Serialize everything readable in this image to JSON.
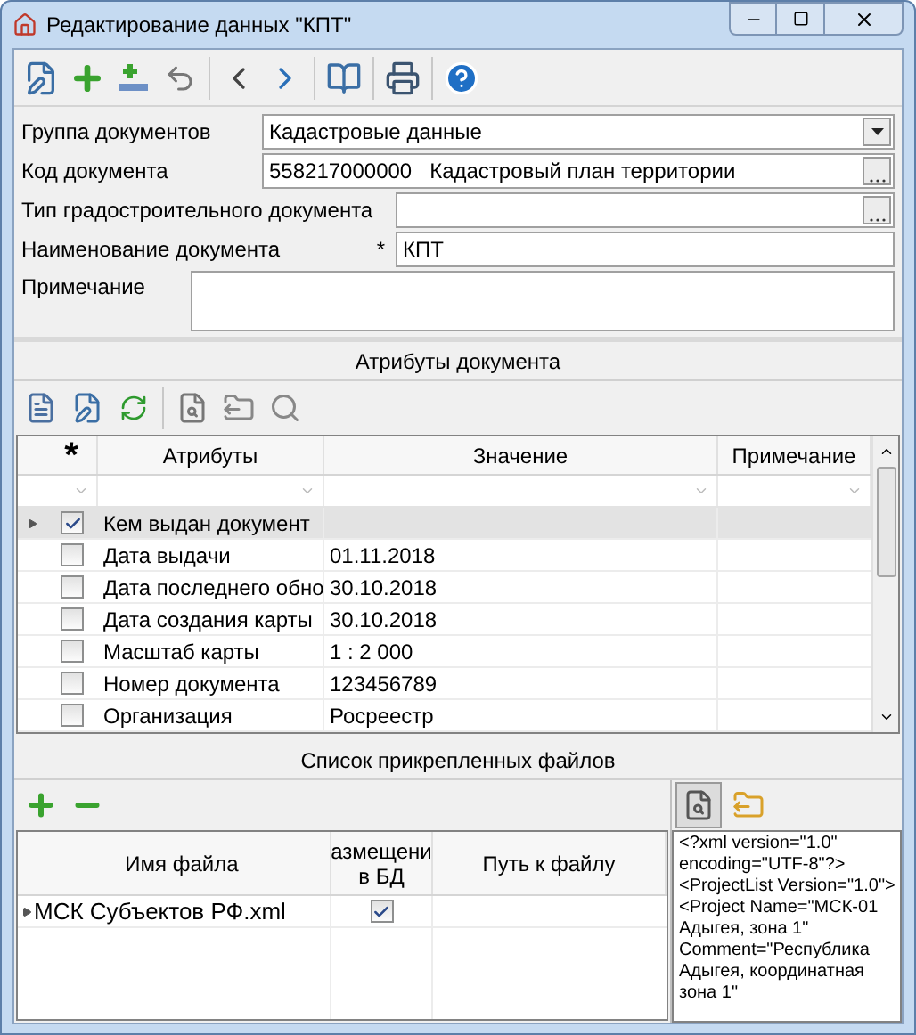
{
  "window": {
    "title": "Редактирование данных \"КПТ\""
  },
  "form": {
    "fields": [
      {
        "kind": "combo",
        "label": "Группа документов",
        "value": "Кадастровые данные"
      },
      {
        "kind": "lookup",
        "label": "Код документа",
        "value": "558217000000   Кадастровый план территории"
      },
      {
        "kind": "lookup",
        "label": "Тип градостроительного документа"
      },
      {
        "kind": "text",
        "label": "Наименование документа",
        "marker": "*",
        "value": "КПТ"
      },
      {
        "kind": "memo",
        "label": "Примечание"
      }
    ]
  },
  "attributes": {
    "title": "Атрибуты документа",
    "columns": [
      "*",
      "Атрибуты",
      "Значение",
      "Примечание"
    ],
    "rows": [
      {
        "selected": true,
        "checked": true,
        "attribute": "Кем выдан документ"
      },
      {
        "selected": false,
        "checked": false,
        "attribute": "Дата выдачи",
        "value": "01.11.2018"
      },
      {
        "selected": false,
        "checked": false,
        "attribute": "Дата последнего обно",
        "value": "30.10.2018"
      },
      {
        "selected": false,
        "checked": false,
        "attribute": "Дата создания карты",
        "value": "30.10.2018"
      },
      {
        "selected": false,
        "checked": false,
        "attribute": "Масштаб карты",
        "value": "1 : 2 000"
      },
      {
        "selected": false,
        "checked": false,
        "attribute": "Номер документа",
        "value": "123456789"
      },
      {
        "selected": false,
        "checked": false,
        "attribute": "Организация",
        "value": "Росреестр"
      }
    ]
  },
  "files": {
    "title": "Список прикрепленных файлов",
    "columns": [
      "Имя файла",
      "азмещени в БД",
      "Путь к файлу"
    ],
    "rows": [
      {
        "selected": true,
        "name": "МСК Субъектов РФ.xml",
        "stored_in_db": true
      }
    ],
    "preview_lines": [
      "<?xml version=\"1.0\"",
      "encoding=\"UTF-8\"?>",
      "<ProjectList Version=\"1.0\">",
      "<Project Name=\"МСК-01",
      "Адыгея, зона 1\"",
      "Comment=\"Республика",
      "Адыгея, координатная",
      "зона 1\""
    ]
  }
}
